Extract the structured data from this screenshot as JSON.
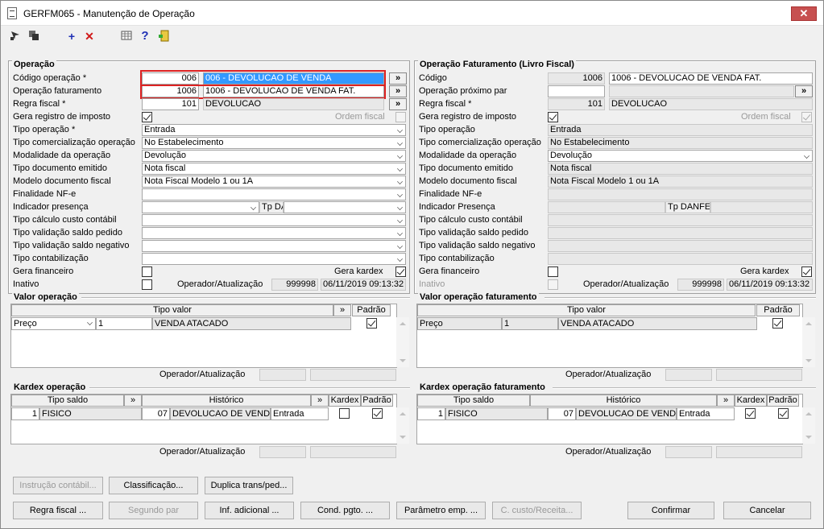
{
  "window": {
    "title": "GERFM065 - Manutenção de Operação",
    "close": "✕"
  },
  "left": {
    "title": "Operação",
    "labels": {
      "codigo": "Código operação *",
      "fat": "Operação faturamento",
      "regra": "Regra fiscal *",
      "gera_reg": "Gera registro de imposto",
      "ordem": "Ordem fiscal",
      "tipo_op": "Tipo operação *",
      "tipo_com": "Tipo comercialização operação",
      "modal": "Modalidade da operação",
      "tipo_doc": "Tipo documento emitido",
      "modelo": "Modelo documento fiscal",
      "finalidade": "Finalidade NF-e",
      "indicador": "Indicador presença",
      "tp_danfe": "Tp DANFE",
      "custo": "Tipo cálculo custo contábil",
      "saldo_pedido": "Tipo validação saldo pedido",
      "saldo_neg": "Tipo validação saldo negativo",
      "contab": "Tipo contabilização",
      "gera_fin": "Gera financeiro",
      "gera_kardex": "Gera kardex",
      "inativo": "Inativo",
      "operador": "Operador/Atualização"
    },
    "values": {
      "codigo": "006",
      "codigo_desc": "006 - DEVOLUCAO DE VENDA",
      "fat": "1006",
      "fat_desc": "1006 - DEVOLUCAO DE VENDA FAT.",
      "regra": "101",
      "regra_desc": "DEVOLUCAO",
      "tipo_op": "Entrada",
      "tipo_com": "No Estabelecimento",
      "modal": "Devolução",
      "tipo_doc": "Nota fiscal",
      "modelo": "Nota Fiscal Modelo 1 ou 1A",
      "operador": "999998",
      "data": "06/11/2019 09:13:32"
    }
  },
  "right": {
    "title": "Operação Faturamento (Livro Fiscal)",
    "labels": {
      "codigo": "Código",
      "proximo": "Operação próximo par",
      "regra": "Regra fiscal *",
      "gera_reg": "Gera registro de imposto",
      "ordem": "Ordem fiscal",
      "tipo_op": "Tipo operação",
      "tipo_com": "Tipo comercialização operação",
      "modal": "Modalidade da operação",
      "tipo_doc": "Tipo documento emitido",
      "modelo": "Modelo documento fiscal",
      "finalidade": "Finalidade NF-e",
      "indicador": "Indicador Presença",
      "tp_danfe": "Tp DANFE",
      "custo": "Tipo cálculo custo contábil",
      "saldo_pedido": "Tipo validação saldo pedido",
      "saldo_neg": "Tipo validação saldo negativo",
      "contab": "Tipo contabilização",
      "gera_fin": "Gera financeiro",
      "gera_kardex": "Gera kardex",
      "inativo": "Inativo",
      "operador": "Operador/Atualização"
    },
    "values": {
      "codigo": "1006",
      "codigo_desc": "1006 - DEVOLUCAO DE VENDA FAT.",
      "regra": "101",
      "regra_desc": "DEVOLUCAO",
      "tipo_op": "Entrada",
      "tipo_com": "No Estabelecimento",
      "modal": "Devolução",
      "tipo_doc": "Nota fiscal",
      "modelo": "Nota Fiscal Modelo 1 ou 1A",
      "operador": "999998",
      "data": "06/11/2019 09:13:32"
    }
  },
  "valor": {
    "left_title": "Valor operação",
    "right_title": "Valor operação faturamento",
    "col_tipo": "Tipo valor",
    "col_padrao": "Padrão",
    "row": {
      "tipo": "Preço",
      "cod": "1",
      "desc": "VENDA ATACADO"
    },
    "operador": "Operador/Atualização"
  },
  "kardex": {
    "left_title": "Kardex operação",
    "right_title": "Kardex operação faturamento",
    "col_saldo": "Tipo saldo",
    "col_hist": "Histórico",
    "col_kardex": "Kardex",
    "col_padrao": "Padrão",
    "row": {
      "cod": "1",
      "saldo": "FISICO",
      "hcod": "07",
      "hist": "DEVOLUCAO DE VENDA",
      "tipo": "Entrada"
    },
    "operador": "Operador/Atualização"
  },
  "arrow": "»",
  "buttons": {
    "instrucao": "Instrução contábil...",
    "classificacao": "Classificação...",
    "duplica": "Duplica trans/ped...",
    "regra": "Regra fiscal ...",
    "segundo": "Segundo par",
    "inf": "Inf. adicional ...",
    "cond": "Cond. pgto. ...",
    "param": "Parâmetro emp. ...",
    "custo": "C. custo/Receita...",
    "confirmar": "Confirmar",
    "cancelar": "Cancelar"
  },
  "colors": {
    "highlight": "#d22222",
    "selection": "#3399ff",
    "close": "#c75050"
  }
}
